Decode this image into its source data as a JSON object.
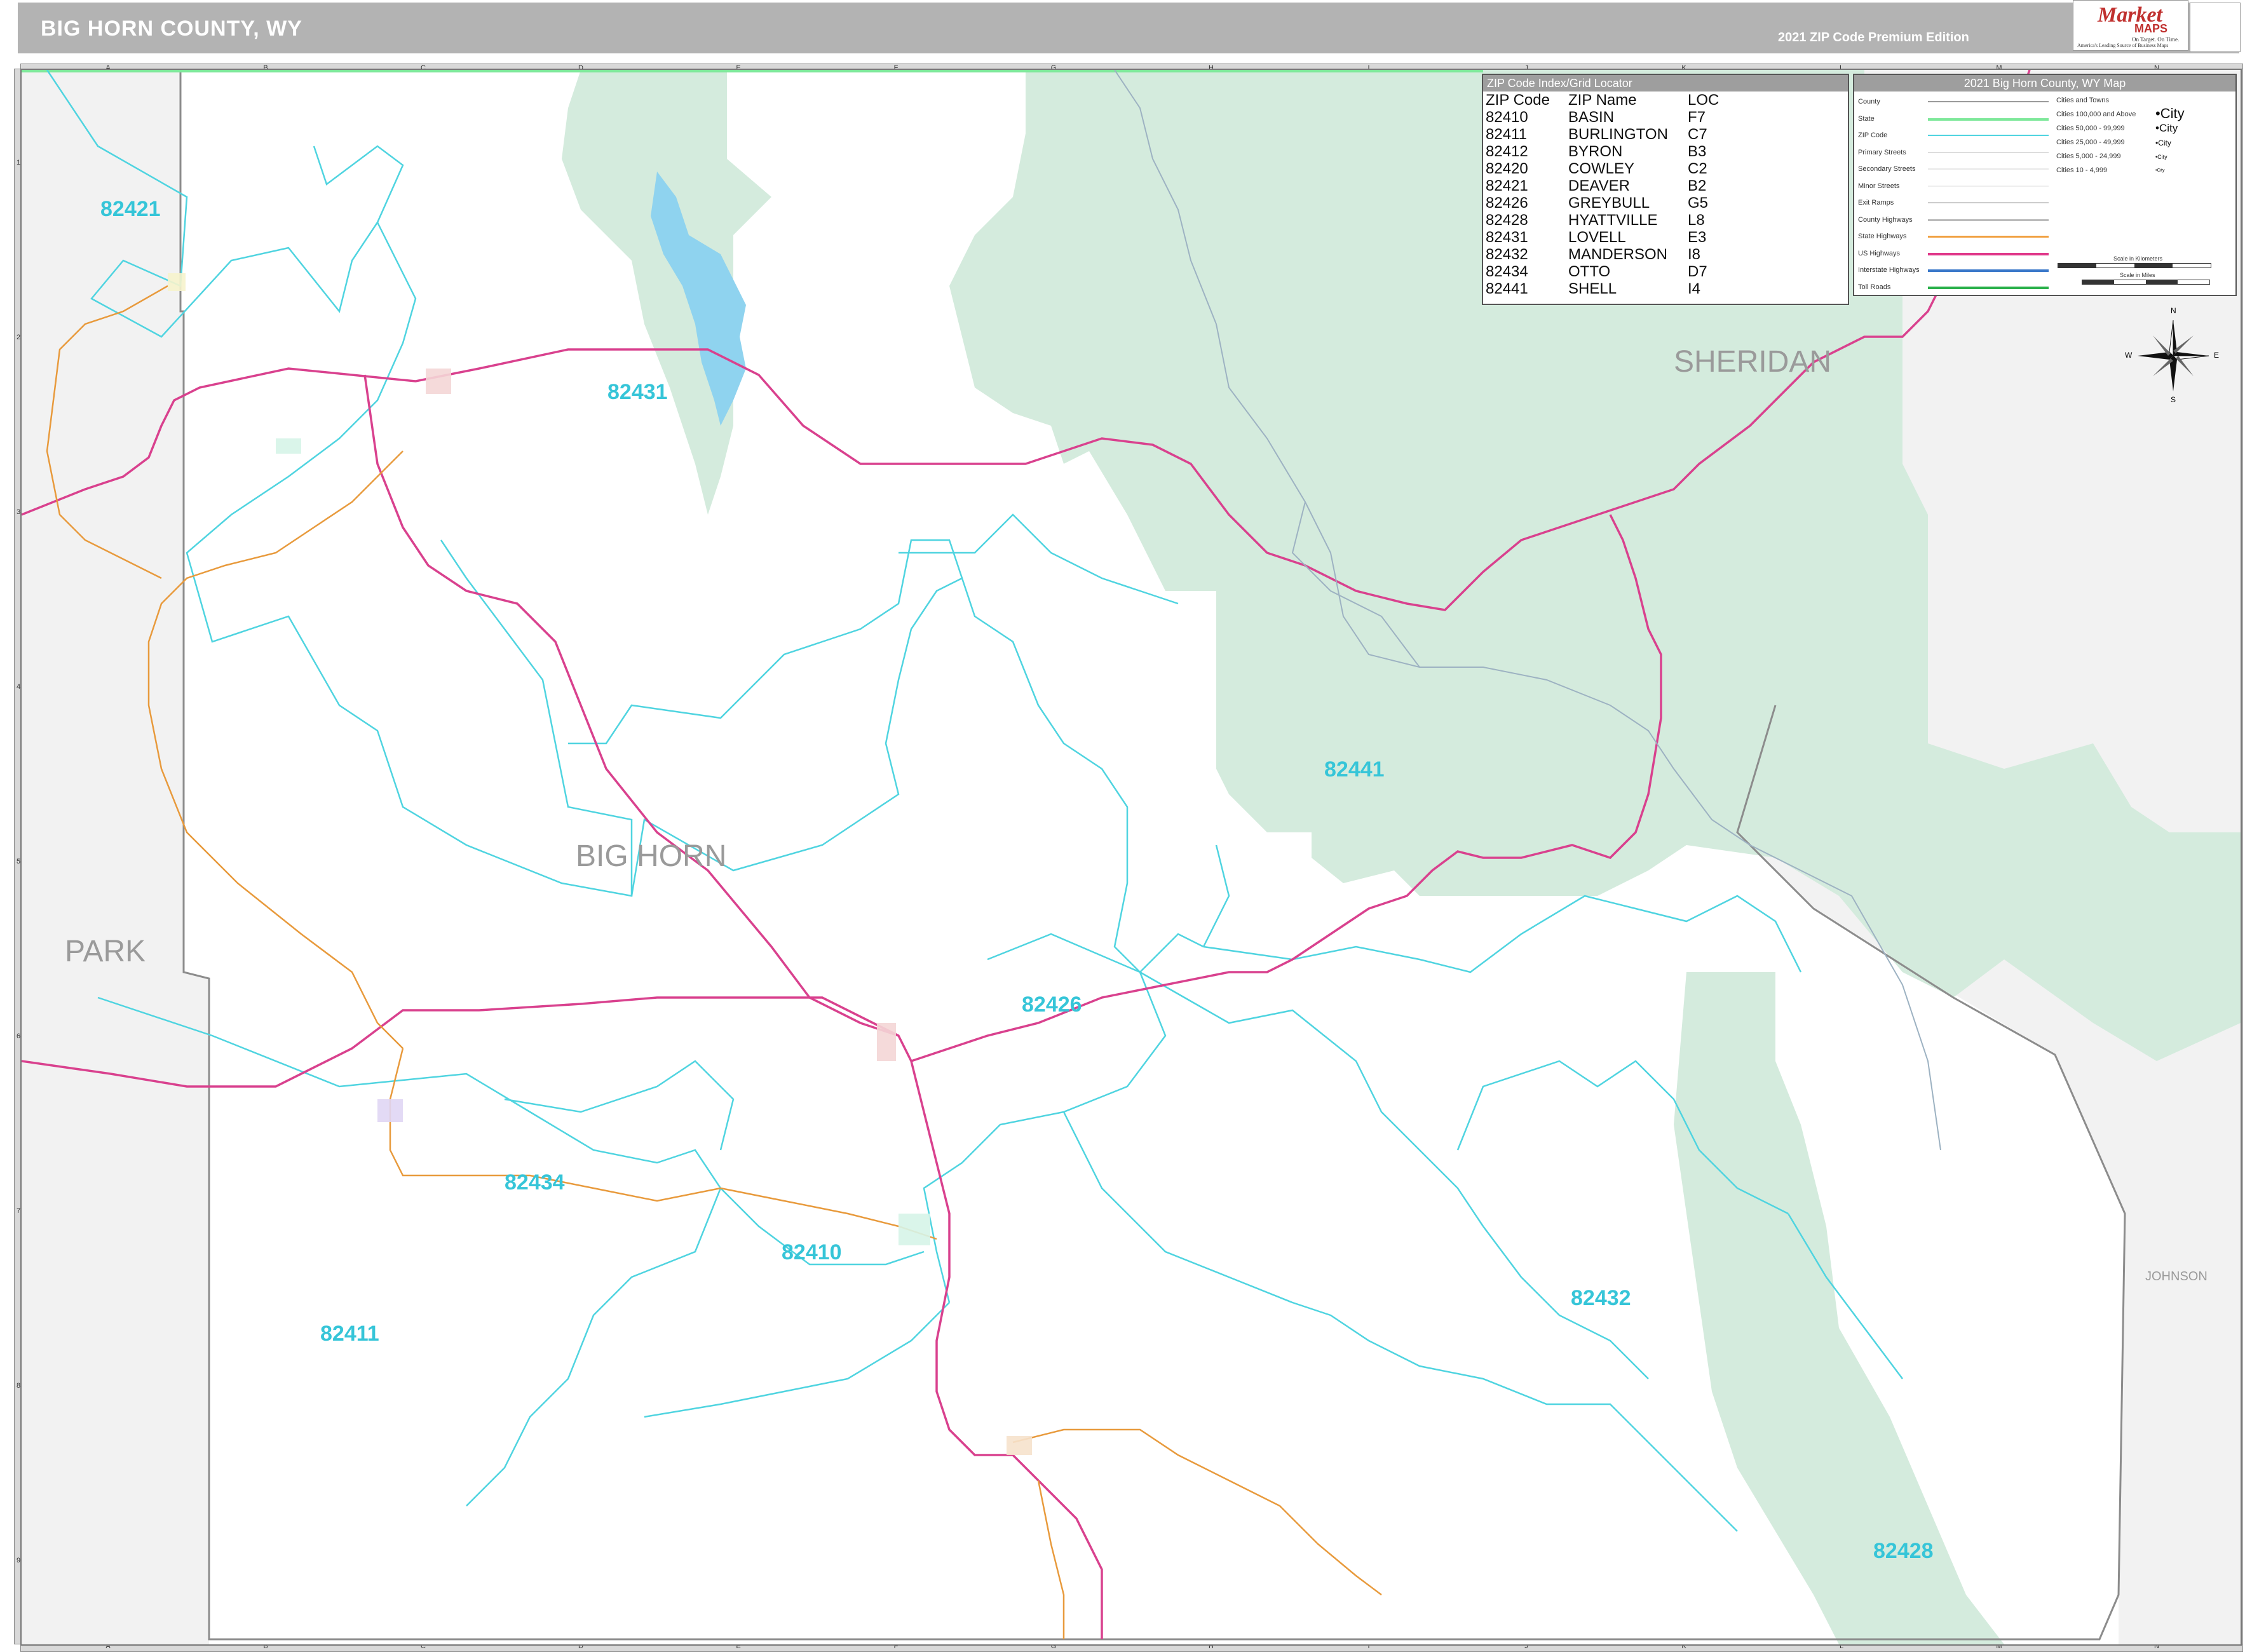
{
  "header": {
    "title": "BIG HORN COUNTY, WY",
    "edition": "2021 ZIP Code Premium Edition",
    "logo_main": "Market",
    "logo_maps": "MAPS",
    "logo_tagline": "On Target. On Time.",
    "logo_subtitle": "America's Leading Source of Business Maps"
  },
  "grid": {
    "columns": [
      "A",
      "B",
      "C",
      "D",
      "E",
      "F",
      "G",
      "H",
      "I",
      "J",
      "K",
      "L",
      "M",
      "N"
    ],
    "rows": [
      "1",
      "2",
      "3",
      "4",
      "5",
      "6",
      "7",
      "8",
      "9"
    ]
  },
  "counties": {
    "big_horn": "BIG HORN",
    "park": "PARK",
    "sheridan": "SHERIDAN",
    "johnson": "JOHNSON"
  },
  "zip_labels": {
    "z82421": "82421",
    "z82431": "82431",
    "z82441": "82441",
    "z82426": "82426",
    "z82434": "82434",
    "z82410": "82410",
    "z82411": "82411",
    "z82432": "82432",
    "z82428": "82428"
  },
  "zip_index": {
    "header": "ZIP Code Index/Grid Locator",
    "columns": [
      "ZIP Code",
      "ZIP Name",
      "LOC"
    ],
    "rows": [
      [
        "82410",
        "BASIN",
        "F7"
      ],
      [
        "82411",
        "BURLINGTON",
        "C7"
      ],
      [
        "82412",
        "BYRON",
        "B3"
      ],
      [
        "82420",
        "COWLEY",
        "C2"
      ],
      [
        "82421",
        "DEAVER",
        "B2"
      ],
      [
        "82426",
        "GREYBULL",
        "G5"
      ],
      [
        "82428",
        "HYATTVILLE",
        "L8"
      ],
      [
        "82431",
        "LOVELL",
        "E3"
      ],
      [
        "82432",
        "MANDERSON",
        "I8"
      ],
      [
        "82434",
        "OTTO",
        "D7"
      ],
      [
        "82441",
        "SHELL",
        "I4"
      ]
    ]
  },
  "legend": {
    "header": "2021 Big Horn County, WY Map",
    "items": [
      {
        "name": "County",
        "color": "#9a9a9a"
      },
      {
        "name": "State",
        "color": "#7ee89a"
      },
      {
        "name": "ZIP Code",
        "color": "#4fd4e0"
      },
      {
        "name": "Primary Streets",
        "color": "#dddddd"
      },
      {
        "name": "Secondary Streets",
        "color": "#e8e8e8"
      },
      {
        "name": "Minor Streets",
        "color": "#eeeeee"
      },
      {
        "name": "Exit Ramps",
        "color": "#cccccc"
      },
      {
        "name": "County Highways",
        "color": "#bbbbbb"
      },
      {
        "name": "State Highways",
        "color": "#f0a040"
      },
      {
        "name": "US Highways",
        "color": "#e0388a"
      },
      {
        "name": "Interstate Highways",
        "color": "#3a78c9"
      },
      {
        "name": "Toll Roads",
        "color": "#2ab04a"
      }
    ],
    "cities_header": "Cities and Towns",
    "cities": [
      {
        "name": "Cities 100,000 and Above",
        "symbol": "•City"
      },
      {
        "name": "Cities 50,000 - 99,999",
        "symbol": "•City"
      },
      {
        "name": "Cities 25,000 - 49,999",
        "symbol": "•City"
      },
      {
        "name": "Cities 5,000 - 24,999",
        "symbol": "•City"
      },
      {
        "name": "Cities 10 - 4,999",
        "symbol": "•City"
      }
    ],
    "scale_km": "Scale in Kilometers",
    "scale_mi": "Scale in Miles"
  },
  "compass": {
    "n": "N",
    "s": "S",
    "e": "E",
    "w": "W"
  },
  "colors": {
    "forest": "#d4ebdd",
    "zip_line": "#4fd4e0",
    "us_highway": "#d9418e",
    "state_highway": "#e89a3c",
    "county_line": "#8c8c8c",
    "outside": "#f2f2f2"
  }
}
